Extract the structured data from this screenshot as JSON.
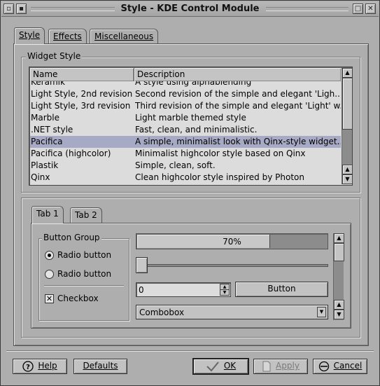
{
  "window": {
    "title": "Style - KDE Control Module",
    "title_buttons": {
      "menu": "▫",
      "sticky": "▪",
      "maximize": "□",
      "close": "✕"
    }
  },
  "tabs": [
    {
      "label": "Style",
      "active": true
    },
    {
      "label": "Effects",
      "active": false
    },
    {
      "label": "Miscellaneous",
      "active": false
    }
  ],
  "widget_style": {
    "group_title": "Widget Style",
    "columns": [
      "Name",
      "Description"
    ],
    "rows": [
      {
        "name": "Keramik",
        "description": "A style using alphablending"
      },
      {
        "name": "Light Style, 2nd revision",
        "description": "Second revision of the simple and elegant 'Ligh..."
      },
      {
        "name": "Light Style, 3rd revision",
        "description": "Third revision of the simple and elegant 'Light' w..."
      },
      {
        "name": "Marble",
        "description": "Light marble themed style"
      },
      {
        "name": ".NET style",
        "description": "Fast, clean, and minimalistic."
      },
      {
        "name": "Pacifica",
        "description": "A simple, minimalist look with Qinx-style widget...",
        "selected": true
      },
      {
        "name": "Pacifica (highcolor)",
        "description": "Minimalist highcolor style based on Qinx"
      },
      {
        "name": "Plastik",
        "description": "Simple, clean, soft."
      },
      {
        "name": "Qinx",
        "description": "Clean highcolor style inspired by Photon"
      }
    ]
  },
  "preview": {
    "tabs": [
      {
        "label": "Tab 1",
        "active": true
      },
      {
        "label": "Tab 2",
        "active": false
      }
    ],
    "button_group": {
      "title": "Button Group",
      "radio1": "Radio button",
      "radio2": "Radio button",
      "radio1_checked": true,
      "radio2_checked": false,
      "checkbox": "Checkbox",
      "checkbox_checked": true
    },
    "progress": {
      "value": 0.7,
      "label": "70%"
    },
    "slider": {
      "value": 0
    },
    "spinbox": {
      "value": "0"
    },
    "button": "Button",
    "combobox": "Combobox"
  },
  "bottom_buttons": {
    "help": "Help",
    "defaults": "Defaults",
    "ok": "OK",
    "apply": "Apply",
    "cancel": "Cancel"
  },
  "colors": {
    "background": "#aeaeae",
    "selection": "#a7aac4",
    "list_background": "#dcdcdc"
  }
}
